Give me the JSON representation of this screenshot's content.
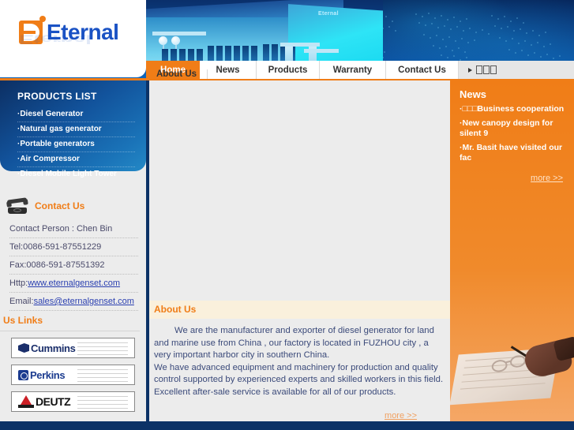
{
  "site": {
    "logo_text": "Eternal"
  },
  "nav": {
    "items": [
      {
        "label": "Home",
        "active": true
      },
      {
        "label": "About Us",
        "active": false
      },
      {
        "label": "News",
        "active": false
      },
      {
        "label": "Products",
        "active": false
      },
      {
        "label": "Warranty",
        "active": false
      },
      {
        "label": "Contact Us",
        "active": false
      },
      {
        "label": "□□□",
        "active": false
      }
    ]
  },
  "products": {
    "title": "PRODUCTS LIST",
    "items": [
      "·Diesel Generator",
      "·Natural gas generator",
      "·Portable generators",
      "·Air Compressor",
      "·Diesel Mobile Light Tower"
    ]
  },
  "contact": {
    "title": "Contact Us",
    "person": "Contact Person : Chen Bin",
    "tel": "Tel:0086-591-87551229",
    "fax": "Fax:0086-591-87551392",
    "http_label": "Http:",
    "http_value": "www.eternalgenset.com",
    "email_label": "Email:",
    "email_value": "sales@eternalgenset.com"
  },
  "uslinks": {
    "title": "Us Links",
    "items": [
      {
        "name": "Cummins"
      },
      {
        "name": "Perkins"
      },
      {
        "name": "DEUTZ"
      }
    ]
  },
  "about": {
    "title": "About Us",
    "paragraph1": "We are the manufacturer and exporter of diesel generator for land and marine use from China , our factory is located in FUZHOU city , a very important harbor city in southern China.",
    "paragraph2": "We have advanced equipment and machinery for production and quality control supported by experienced experts and skilled workers in this field. Excellent after-sale service is available for all of our products.",
    "more_label": "more >>"
  },
  "news": {
    "title": "News",
    "items": [
      "·□□□Business cooperation",
      "·New canopy design for silent 9",
      "·Mr. Basit have visited our fac"
    ],
    "more_label": "more >>"
  },
  "banner": {
    "factory_logo": "Eternal"
  },
  "colors": {
    "accent_orange": "#f07d17",
    "deep_navy": "#0c3266",
    "link_blue": "#2a3fb0",
    "body_gray": "#ececec",
    "cream": "#faf0dc"
  }
}
